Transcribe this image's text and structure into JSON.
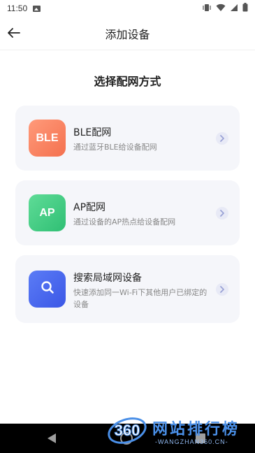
{
  "status_bar": {
    "time": "11:50",
    "icons": [
      "image-icon",
      "vibrate-icon",
      "wifi-icon",
      "signal-icon",
      "battery-icon"
    ]
  },
  "app_bar": {
    "title": "添加设备",
    "back_icon": "arrow-left-icon"
  },
  "section_title": "选择配网方式",
  "options": [
    {
      "badge": "BLE",
      "title": "BLE配网",
      "desc": "通过蓝牙BLE给设备配网",
      "color": "#f4714f"
    },
    {
      "badge": "AP",
      "title": "AP配网",
      "desc": "通过设备的AP热点给设备配网",
      "color": "#2fbf74"
    },
    {
      "badge_icon": "search-icon",
      "title": "搜索局域网设备",
      "desc": "快速添加同一Wi-Fi下其他用户已绑定的设备",
      "color": "#3b57e6"
    }
  ],
  "watermark": {
    "logo_text": "360",
    "text": "网站排行榜",
    "subtext": "-WANGZHAN360.CN-"
  }
}
